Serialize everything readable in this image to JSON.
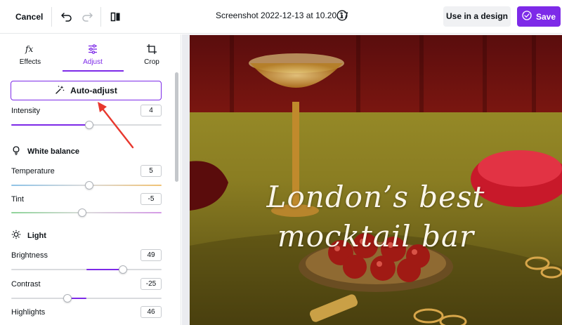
{
  "topbar": {
    "cancel_label": "Cancel",
    "doc_title": "Screenshot 2022-12-13 at 10.20.17",
    "use_in_design_label": "Use in a design",
    "save_label": "Save",
    "icons": [
      "undo-icon",
      "redo-icon",
      "flip-icon",
      "info-icon",
      "check-circle-icon"
    ]
  },
  "tabs": [
    {
      "label": "Effects",
      "icon": "fx-icon",
      "active": false
    },
    {
      "label": "Adjust",
      "icon": "sliders-icon",
      "active": true
    },
    {
      "label": "Crop",
      "icon": "crop-icon",
      "active": false
    }
  ],
  "auto_adjust": {
    "label": "Auto-adjust",
    "icon": "magic-wand-icon"
  },
  "intensity": {
    "label": "Intensity",
    "value": "4",
    "level": 0.52
  },
  "white_balance": {
    "title": "White balance",
    "icon": "bulb-icon",
    "temperature": {
      "label": "Temperature",
      "value": "5",
      "level": 0.52
    },
    "tint": {
      "label": "Tint",
      "value": "-5",
      "level": 0.47
    }
  },
  "light": {
    "title": "Light",
    "icon": "sun-icon",
    "brightness": {
      "label": "Brightness",
      "value": "49",
      "level": 0.745
    },
    "contrast": {
      "label": "Contrast",
      "value": "-25",
      "level": 0.375
    },
    "highlights": {
      "label": "Highlights",
      "value": "46"
    }
  },
  "photo": {
    "headline_line1": "London’s best",
    "headline_line2": "mocktail bar"
  },
  "colors": {
    "accent": "#7d2ae8",
    "annotation_arrow": "#e8382e"
  }
}
